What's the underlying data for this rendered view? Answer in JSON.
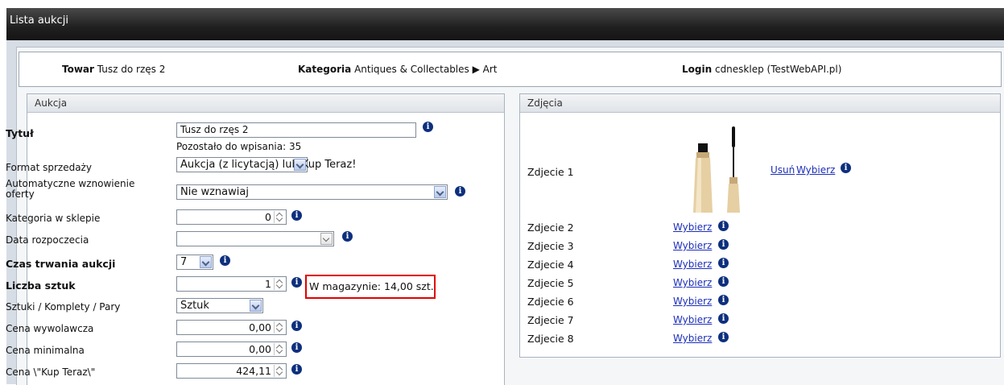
{
  "window": {
    "title": "Lista aukcji"
  },
  "header": {
    "towar_label": "Towar",
    "towar_value": "Tusz do rzęs 2",
    "kategoria_label": "Kategoria",
    "kategoria_value": "Antiques & Collectables ▶ Art",
    "login_label": "Login",
    "login_value": "cdnesklep (TestWebAPI.pl)"
  },
  "aukcja": {
    "panel_title": "Aukcja",
    "tytul": {
      "label": "Tytuł",
      "value": "Tusz do rzęs 2",
      "hint": "Pozostało do wpisania: 35"
    },
    "format": {
      "label": "Format sprzedaży",
      "value": "Aukcja (z licytacją) lub Kup Teraz!"
    },
    "wznowienie": {
      "label_line1": "Automatyczne wznowienie",
      "label_line2": "oferty",
      "value": "Nie wznawiaj"
    },
    "kategoria_sklep": {
      "label": "Kategoria w sklepie",
      "value": "0"
    },
    "data": {
      "label": "Data rozpoczecia",
      "value": ""
    },
    "czas": {
      "label": "Czas trwania aukcji",
      "value": "7"
    },
    "liczba": {
      "label": "Liczba sztuk",
      "value": "1",
      "stock": "W magazynie: 14,00 szt."
    },
    "sztuki": {
      "label": "Sztuki / Komplety / Pary",
      "value": "Sztuk"
    },
    "cena_wyw": {
      "label": "Cena wywolawcza",
      "value": "0,00"
    },
    "cena_min": {
      "label": "Cena minimalna",
      "value": "0,00"
    },
    "cena_kup": {
      "label": "Cena \\\"Kup Teraz\\\"",
      "value": "424,11"
    }
  },
  "zdjecia": {
    "panel_title": "Zdjęcia",
    "remove_label": "Usuń",
    "choose_label": "Wybierz",
    "rows": [
      "Zdjecie 1",
      "Zdjecie 2",
      "Zdjecie 3",
      "Zdjecie 4",
      "Zdjecie 5",
      "Zdjecie 6",
      "Zdjecie 7",
      "Zdjecie 8"
    ]
  },
  "colors": {
    "title_bar": "#1f1f1f",
    "link": "#1c2fb8",
    "info_icon": "#0d2f7d",
    "highlight_border": "#e00000"
  },
  "icons": {
    "info": "info-icon",
    "dropdown": "chevron-down-icon",
    "spinner": "spinner-arrows-icon"
  }
}
